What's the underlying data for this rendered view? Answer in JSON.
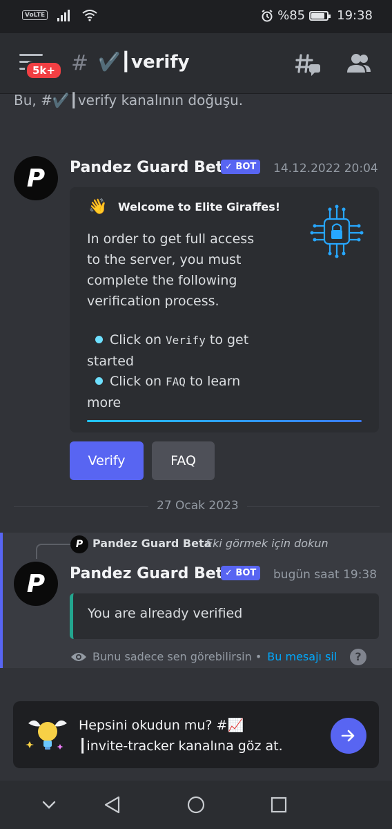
{
  "status_bar": {
    "network_badge": "VoLTE",
    "battery": "%85",
    "battery_level": 0.85,
    "time": "19:38"
  },
  "header": {
    "unread_badge": "5k+",
    "channel_prefix": "#",
    "channel_name": "✔️┃verify",
    "icons": [
      "menu-icon",
      "threads-icon",
      "members-icon"
    ]
  },
  "channel_intro": "Bu, #✔️┃verify kanalının doğuşu.",
  "messages": [
    {
      "author": "Pandez Guard Beta",
      "bot_badge": "✓ BOT",
      "timestamp": "14.12.2022 20:04",
      "embed": {
        "emoji": "👋",
        "title": "Welcome to Elite Giraffes!",
        "description": "In order to get full access to the server, you must complete the following verification process.",
        "bullets": [
          {
            "pre": "Click on ",
            "code": "Verify",
            "post": " to get started"
          },
          {
            "pre": "Click on ",
            "code": "FAQ",
            "post": " to learn more"
          }
        ]
      },
      "buttons": [
        "Verify",
        "FAQ"
      ]
    }
  ],
  "date_divider": "27 Ocak 2023",
  "ephemeral": {
    "reply_author": "Pandez Guard Beta",
    "reply_hint": "Eki görmek için dokun",
    "author": "Pandez Guard Beta",
    "bot_badge": "✓ BOT",
    "timestamp": "bugün saat 19:38",
    "embed_text": "You are already verified",
    "note": "Bunu sadece sen görebilirsin •",
    "delete_link": "Bu mesajı sil",
    "help": "?"
  },
  "prompt": {
    "line1": "Hepsini okudun mu? #📈",
    "line2": "┃invite-tracker kanalına göz at."
  },
  "colors": {
    "background": "#313338",
    "header": "#2b2d31",
    "blurple": "#5865f2",
    "embed_border_green": "#23a58e",
    "link": "#00a8fc",
    "badge_red": "#f23f43"
  }
}
